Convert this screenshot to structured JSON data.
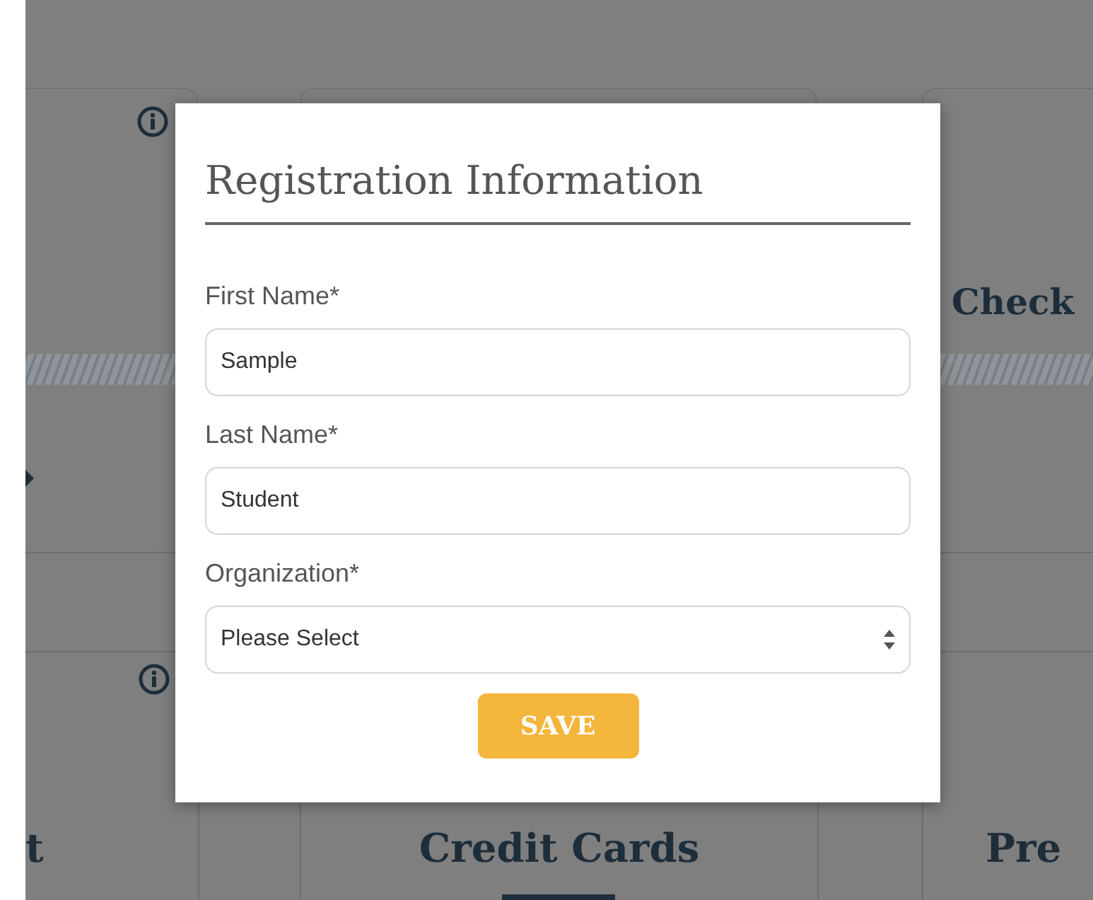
{
  "background": {
    "top_row_title": "Check",
    "bottom_row_titles": [
      "t",
      "Credit Cards",
      "Pre"
    ]
  },
  "dialog": {
    "title": "Registration Information",
    "fields": [
      {
        "kind": "text",
        "label": "First Name*",
        "value": "Sample"
      },
      {
        "kind": "text",
        "label": "Last Name*",
        "value": "Student"
      },
      {
        "kind": "select",
        "label": "Organization*",
        "value": "Please Select"
      }
    ],
    "button": "SAVE"
  }
}
